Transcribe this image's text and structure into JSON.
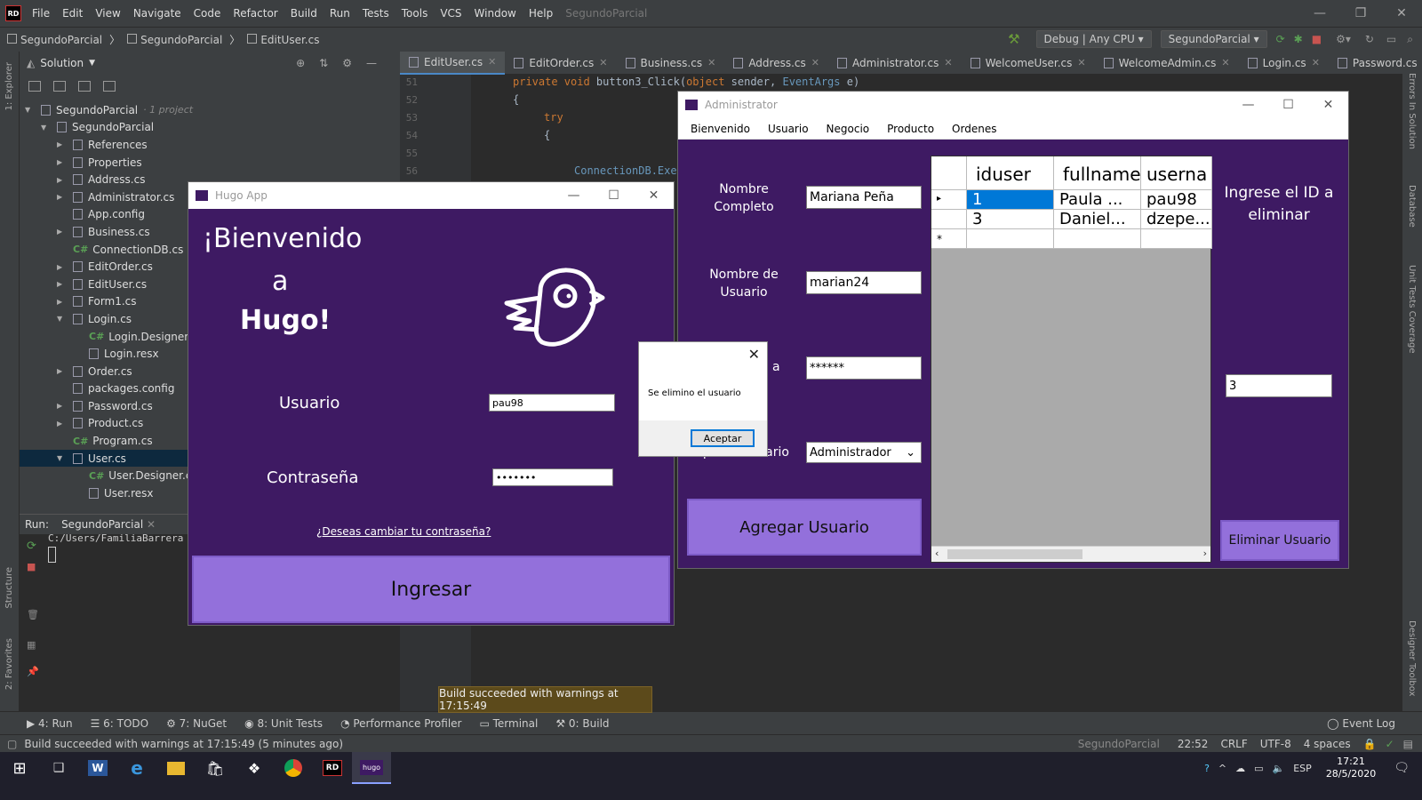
{
  "ide": {
    "menu": [
      "File",
      "Edit",
      "View",
      "Navigate",
      "Code",
      "Refactor",
      "Build",
      "Run",
      "Tests",
      "Tools",
      "VCS",
      "Window",
      "Help"
    ],
    "project_name": "SegundoParcial",
    "breadcrumb": [
      "SegundoParcial",
      "SegundoParcial",
      "EditUser.cs"
    ],
    "config": "Debug | Any CPU",
    "run_config": "SegundoParcial",
    "solution_label": "Solution",
    "tree": [
      {
        "label": "SegundoParcial",
        "note": "· 1 project",
        "indent": 0,
        "arrow": "▼"
      },
      {
        "label": "SegundoParcial",
        "indent": 1,
        "arrow": "▼"
      },
      {
        "label": "References",
        "indent": 2,
        "arrow": "▶"
      },
      {
        "label": "Properties",
        "indent": 2,
        "arrow": "▶"
      },
      {
        "label": "Address.cs",
        "indent": 2,
        "arrow": "▶"
      },
      {
        "label": "Administrator.cs",
        "indent": 2,
        "arrow": "▶"
      },
      {
        "label": "App.config",
        "indent": 2,
        "arrow": ""
      },
      {
        "label": "Business.cs",
        "indent": 2,
        "arrow": "▶"
      },
      {
        "label": "ConnectionDB.cs",
        "indent": 2,
        "arrow": "",
        "cs": true
      },
      {
        "label": "EditOrder.cs",
        "indent": 2,
        "arrow": "▶"
      },
      {
        "label": "EditUser.cs",
        "indent": 2,
        "arrow": "▶"
      },
      {
        "label": "Form1.cs",
        "indent": 2,
        "arrow": "▶"
      },
      {
        "label": "Login.cs",
        "indent": 2,
        "arrow": "▼"
      },
      {
        "label": "Login.Designer.cs",
        "indent": 3,
        "arrow": "",
        "cs": true
      },
      {
        "label": "Login.resx",
        "indent": 3,
        "arrow": ""
      },
      {
        "label": "Order.cs",
        "indent": 2,
        "arrow": "▶"
      },
      {
        "label": "packages.config",
        "indent": 2,
        "arrow": ""
      },
      {
        "label": "Password.cs",
        "indent": 2,
        "arrow": "▶"
      },
      {
        "label": "Product.cs",
        "indent": 2,
        "arrow": "▶"
      },
      {
        "label": "Program.cs",
        "indent": 2,
        "arrow": "",
        "cs": true
      },
      {
        "label": "User.cs",
        "indent": 2,
        "arrow": "▼",
        "selected": true
      },
      {
        "label": "User.Designer.cs",
        "indent": 3,
        "arrow": "",
        "cs": true
      },
      {
        "label": "User.resx",
        "indent": 3,
        "arrow": ""
      }
    ],
    "run_label": "Run:",
    "run_tab": "SegundoParcial",
    "run_output": "C:/Users/FamiliaBarrera",
    "tabs": [
      "EditUser.cs",
      "EditOrder.cs",
      "Business.cs",
      "Address.cs",
      "Administrator.cs",
      "WelcomeUser.cs",
      "WelcomeAdmin.cs",
      "Login.cs",
      "Password.cs"
    ],
    "line_numbers": [
      "51",
      "52",
      "53",
      "54",
      "55",
      "56"
    ],
    "code": {
      "l51a": "private void ",
      "l51b": "button3_Click(",
      "l51c": "object",
      "l51d": " sender, ",
      "l51e": "EventArgs",
      "l51f": " e)",
      "l52": "{",
      "l53": "try",
      "l54": "{",
      "l56": "ConnectionDB.Exec"
    },
    "bottom_tools": [
      "4: Run",
      "6: TODO",
      "7: NuGet",
      "8: Unit Tests",
      "Performance Profiler",
      "Terminal",
      "0: Build"
    ],
    "event_log": "Event Log",
    "status_left": "Build succeeded with warnings at 17:15:49 (5 minutes ago)",
    "status_right": [
      "SegundoParcial",
      "22:52",
      "CRLF",
      "UTF-8",
      "4 spaces"
    ],
    "toast": "Build succeeded with warnings at 17:15:49",
    "left_strip": [
      "1: Explorer",
      "Structure",
      "2: Favorites"
    ],
    "right_strip": [
      "Errors In Solution",
      "Database",
      "Unit Tests Coverage",
      "Designer Toolbox"
    ]
  },
  "hugo_app": {
    "title": "Hugo App",
    "welcome_l1": "¡Bienvenido",
    "welcome_l2": "a",
    "welcome_l3": "Hugo!",
    "user_label": "Usuario",
    "user_value": "pau98",
    "pass_label": "Contraseña",
    "pass_value": "•••••••",
    "change_link": "¿Deseas cambiar tu contraseña?",
    "login_button": "Ingresar"
  },
  "admin": {
    "title": "Administrator",
    "menu": [
      "Bienvenido",
      "Usuario",
      "Negocio",
      "Producto",
      "Ordenes"
    ],
    "fullname_label": "Nombre Completo",
    "fullname_value": "Mariana Peña",
    "username_label": "Nombre de Usuario",
    "username_value": "marian24",
    "password_label_fragment": "a",
    "password_value": "******",
    "usertype_label_fragment": "ipo de Usuario",
    "usertype_value": "Administrador",
    "add_button": "Agregar Usuario",
    "grid_columns": [
      "iduser",
      "fullname",
      "userna"
    ],
    "grid_rows": [
      {
        "marker": "▸",
        "iduser": "1",
        "fullname": "Paula ...",
        "username": "pau98",
        "selected": true
      },
      {
        "marker": "",
        "iduser": "3",
        "fullname": "Daniel...",
        "username": "dzepe..."
      }
    ],
    "grid_new_marker": "*",
    "delete_prompt": "Ingrese el ID a eliminar",
    "delete_id_value": "3",
    "delete_button": "Eliminar Usuario"
  },
  "dialog": {
    "message": "Se elimino el usuario",
    "ok_button": "Aceptar"
  },
  "taskbar": {
    "language": "ESP",
    "time": "17:21",
    "date": "28/5/2020"
  },
  "colors": {
    "ide_bg": "#2b2b2b",
    "ide_panel": "#3c3f41",
    "app_purple": "#3e1a63",
    "button_purple": "#9370db",
    "selection_blue": "#0078d7"
  }
}
